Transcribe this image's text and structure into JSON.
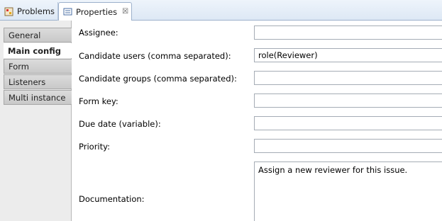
{
  "tabs": [
    {
      "label": "Problems",
      "icon": "problems-icon"
    },
    {
      "label": "Properties",
      "icon": "properties-icon",
      "close": "☒"
    }
  ],
  "nav": {
    "items": [
      {
        "label": "General"
      },
      {
        "label": "Main config"
      },
      {
        "label": "Form"
      },
      {
        "label": "Listeners"
      },
      {
        "label": "Multi instance"
      }
    ],
    "active": "Main config"
  },
  "form": {
    "assignee": {
      "label": "Assignee:",
      "value": ""
    },
    "candidate_users": {
      "label": "Candidate users (comma separated):",
      "value": "role(Reviewer)"
    },
    "candidate_groups": {
      "label": "Candidate groups (comma separated):",
      "value": ""
    },
    "form_key": {
      "label": "Form key:",
      "value": ""
    },
    "due_date": {
      "label": "Due date (variable):",
      "value": ""
    },
    "priority": {
      "label": "Priority:",
      "value": ""
    },
    "documentation": {
      "label": "Documentation:",
      "value": "Assign a new reviewer for this issue."
    }
  },
  "colors": {
    "tab_bg": "#dde8f5",
    "nav_bg": "#ececec"
  }
}
